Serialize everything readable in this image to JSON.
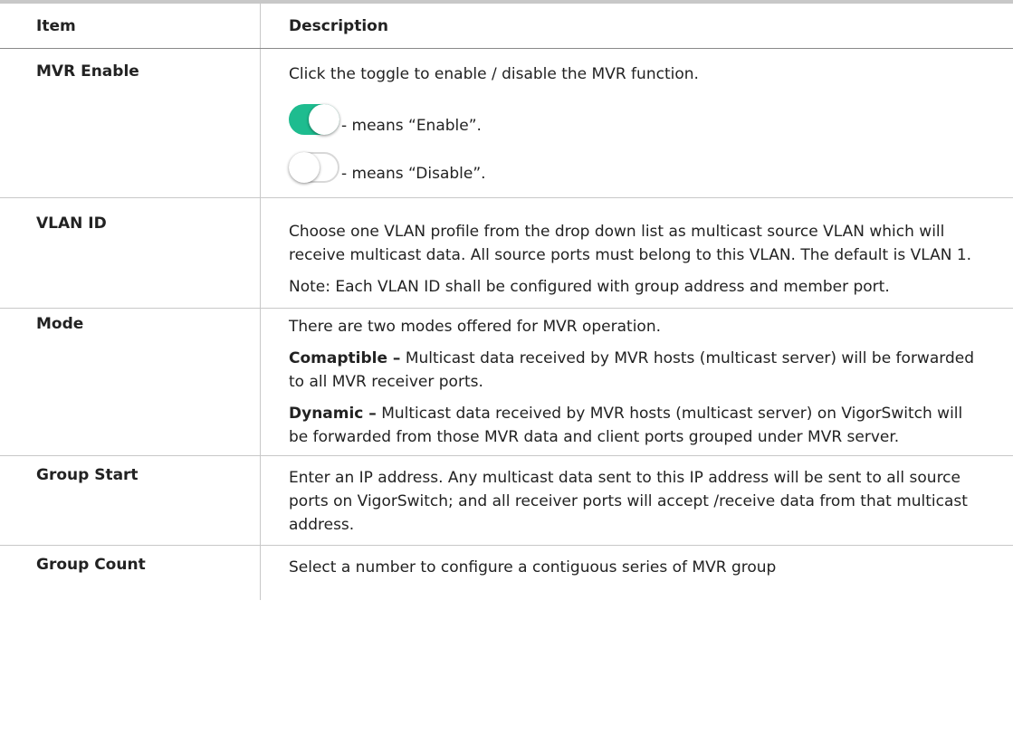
{
  "header": {
    "item": "Item",
    "description": "Description"
  },
  "rows": {
    "mvr_enable": {
      "item": "MVR Enable",
      "text": "Click the toggle to enable / disable the MVR function.",
      "enable_text": "- means “Enable”.",
      "disable_text": "- means “Disable”.",
      "toggle_on_color": "#1ebc8f"
    },
    "vlan_id": {
      "item": "VLAN ID",
      "text": "Choose one VLAN profile from the drop down list as multicast source VLAN which will receive multicast data. All source ports must belong to this VLAN. The default is VLAN 1.",
      "note": "Note: Each VLAN ID shall be configured with group address and member port."
    },
    "mode": {
      "item": "Mode",
      "text": "There are two modes offered for MVR operation.",
      "compatible_label": "Comaptible –",
      "compatible_text": " Multicast data received by MVR hosts (multicast server) will be forwarded to all MVR receiver ports.",
      "dynamic_label": "Dynamic –",
      "dynamic_text": " Multicast data received by MVR hosts (multicast server) on VigorSwitch will be forwarded from those MVR data and client ports grouped under MVR server."
    },
    "group_start": {
      "item": "Group Start",
      "text": "Enter an IP address. Any multicast data sent to this IP address will be sent to all source ports on VigorSwitch; and all receiver ports will accept /receive data from that multicast address."
    },
    "group_count": {
      "item": "Group Count",
      "text": "Select a number to configure a contiguous series of MVR group"
    }
  }
}
